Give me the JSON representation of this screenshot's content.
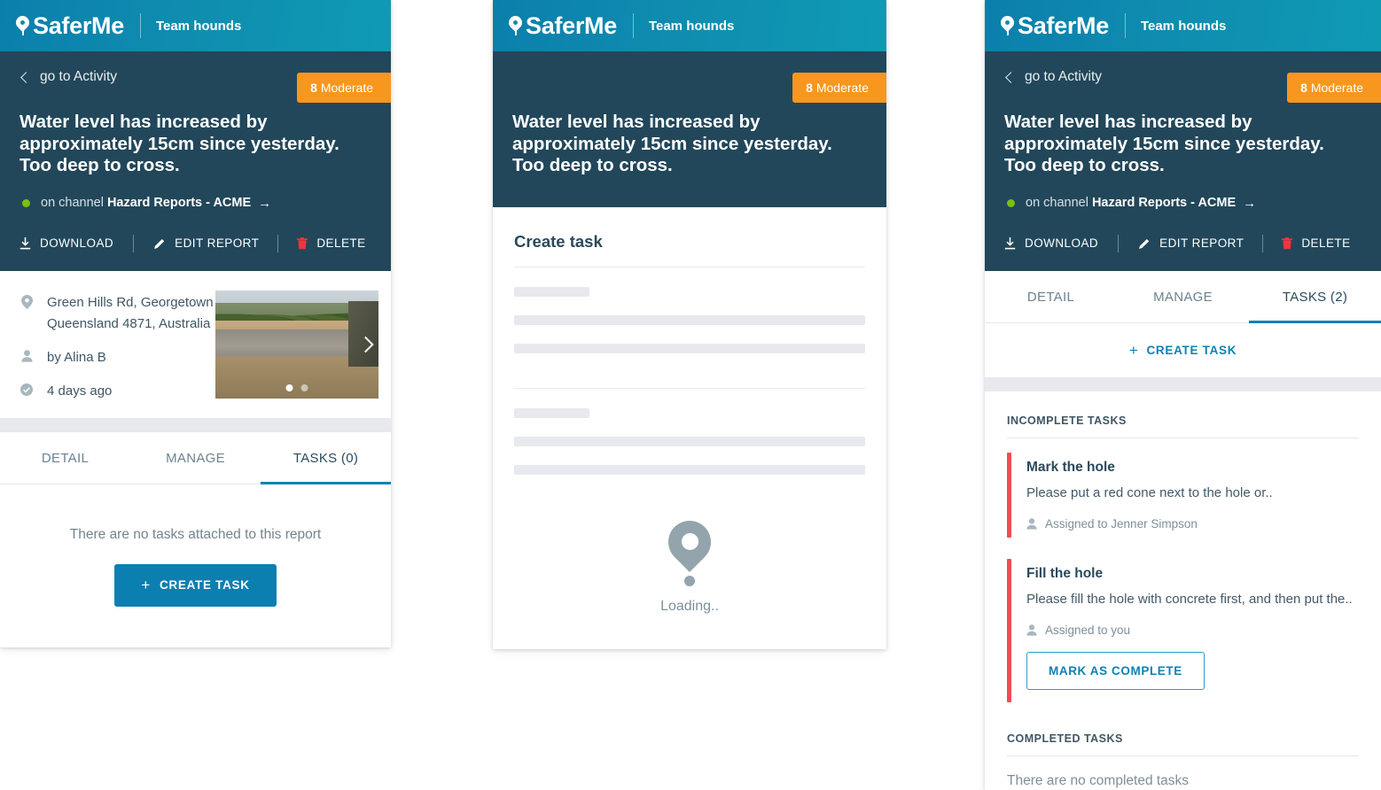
{
  "brand": {
    "name": "SaferMe",
    "team": "Team hounds",
    "pin_icon": "location-pin-icon"
  },
  "report": {
    "back_label": "go to Activity",
    "back_icon": "chevron-left-icon",
    "severity_score": "8",
    "severity_label": "Moderate",
    "title": "Water level has increased by approximately 15cm since yesterday. Too deep to cross.",
    "channel_prefix": "on channel",
    "channel_name": "Hazard Reports - ACME",
    "channel_arrow": "→",
    "actions": {
      "download": "DOWNLOAD",
      "edit": "EDIT REPORT",
      "delete": "DELETE"
    }
  },
  "detail": {
    "location_icon": "map-pin-icon",
    "location": "Green Hills Rd, Georgetown Queensland 4871, Australia",
    "author_icon": "person-icon",
    "author": "by Alina B",
    "time_icon": "clock-check-icon",
    "time": "4 days ago",
    "photo_next_icon": "chevron-right-icon",
    "photo_dots": 2,
    "photo_active_dot": 0
  },
  "tabs": {
    "detail": "DETAIL",
    "manage": "MANAGE",
    "tasks_empty": "TASKS (0)",
    "tasks_filled": "TASKS (2)"
  },
  "tasks_empty": {
    "message": "There are no tasks attached to this report",
    "create_button": "CREATE TASK",
    "plus_icon": "plus-icon"
  },
  "create_task_modal": {
    "heading": "Create task",
    "loading_text": "Loading..",
    "loading_icon": "location-pin-icon",
    "skeleton_groups": [
      {
        "label_width": 85,
        "fields": 2
      },
      {
        "label_width": 85,
        "fields": 2
      }
    ]
  },
  "tasks_panel": {
    "create_link": "CREATE TASK",
    "plus_icon": "plus-icon",
    "incomplete_heading": "INCOMPLETE TASKS",
    "completed_heading": "COMPLETED TASKS",
    "completed_empty": "There are no completed tasks",
    "incomplete": [
      {
        "title": "Mark the hole",
        "description": "Please put a red cone next to the hole or..",
        "assigned_icon": "person-icon",
        "assigned": "Assigned to Jenner Simpson",
        "action": null
      },
      {
        "title": "Fill the hole",
        "description": "Please fill the hole with concrete first, and then put the..",
        "assigned_icon": "person-icon",
        "assigned": "Assigned to you",
        "action": "MARK AS COMPLETE"
      }
    ]
  },
  "colors": {
    "brand_teal_start": "#0b7fab",
    "brand_teal_end": "#0f9ab4",
    "header_navy": "#22475a",
    "severity_orange": "#f7971d",
    "channel_green": "#7cc00f",
    "accent_blue": "#0c82b4",
    "task_bar_red": "#f04e4e",
    "delete_red": "#f0343c",
    "grey_band": "#e7e9ee"
  }
}
